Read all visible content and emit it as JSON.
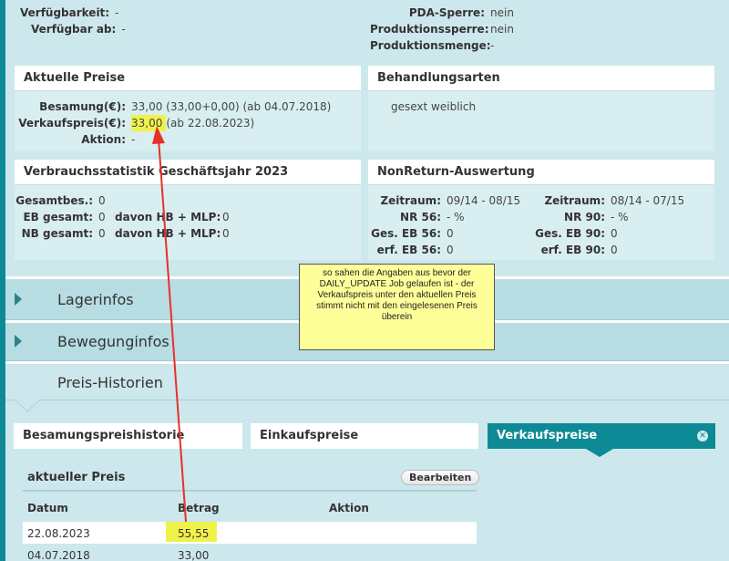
{
  "top": {
    "left": [
      {
        "label": "Verfügbarkeit:",
        "value": "-"
      },
      {
        "label": "Verfügbar ab:",
        "value": "-"
      }
    ],
    "right": [
      {
        "label": "PDA-Sperre:",
        "value": "nein"
      },
      {
        "label": "Produktionssperre:",
        "value": "nein"
      },
      {
        "label": "Produktionsmenge:",
        "value": "-"
      }
    ]
  },
  "prices": {
    "title": "Aktuelle Preise",
    "besamung_label": "Besamung(€):",
    "besamung_value": "33,00 (33,00+0,00) (ab 04.07.2018)",
    "verkauf_label": "Verkaufspreis(€):",
    "verkauf_value": "33,00",
    "verkauf_since": " (ab 22.08.2023)",
    "aktion_label": "Aktion:",
    "aktion_value": "-"
  },
  "treatment": {
    "title": "Behandlungsarten",
    "text": "gesext weiblich"
  },
  "usage": {
    "title": "Verbrauchsstatistik Geschäftsjahr 2023",
    "gesamt_label": "Gesamtbes.:",
    "gesamt_value": "0",
    "eb_label": "EB gesamt:",
    "eb_value": "0",
    "eb_davon_label": "davon HB + MLP:",
    "eb_davon_value": "0",
    "nb_label": "NB gesamt:",
    "nb_value": "0",
    "nb_davon_label": "davon HB + MLP:",
    "nb_davon_value": "0"
  },
  "nonreturn": {
    "title": "NonReturn-Auswertung",
    "zeitraum_label": "Zeitraum:",
    "zeitraum_1": "09/14 - 08/15",
    "zeitraum_2": "08/14 - 07/15",
    "nr56_label": "NR 56:",
    "nr56_value": "- %",
    "nr90_label": "NR 90:",
    "nr90_value": "- %",
    "geseb56_label": "Ges. EB 56:",
    "geseb56_value": "0",
    "geseb90_label": "Ges. EB 90:",
    "geseb90_value": "0",
    "erfeb56_label": "erf. EB 56:",
    "erfeb56_value": "0",
    "erfeb90_label": "erf. EB 90:",
    "erfeb90_value": "0"
  },
  "sections": {
    "lager": "Lagerinfos",
    "bewegung": "Bewegunginfos",
    "historie": "Preis-Historien"
  },
  "tabs": {
    "besamung": "Besamungspreishistorie",
    "einkauf": "Einkaufspreise",
    "verkauf": "Verkaufspreise"
  },
  "history": {
    "title": "aktueller Preis",
    "edit_button": "Bearbeiten",
    "col_datum": "Datum",
    "col_betrag": "Betrag",
    "col_aktion": "Aktion",
    "rows": [
      {
        "datum": "22.08.2023",
        "betrag": "55,55",
        "aktion": ""
      },
      {
        "datum": "04.07.2018",
        "betrag": "33,00",
        "aktion": ""
      }
    ]
  },
  "note": {
    "text": "so sahen die Angaben aus  bevor der DAILY_UPDATE Job gelaufen ist - der Verkaufspreis unter den aktuellen Preis stimmt nicht mit den eingelesenen Preis überein"
  },
  "colors": {
    "accent": "#0e8a96",
    "highlight": "#f0f24a",
    "arrow": "#e8302a",
    "note_bg": "#ffff99"
  }
}
